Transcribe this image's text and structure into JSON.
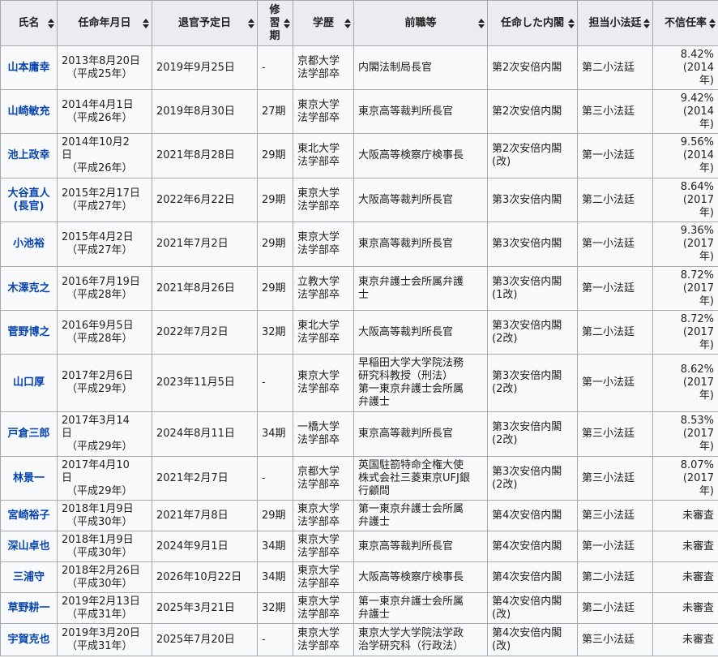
{
  "headers": [
    "氏名",
    "任命年月日",
    "退官予定日",
    "修習期",
    "学歴",
    "前職等",
    "任命した内閣",
    "担当小法廷",
    "不信任率"
  ],
  "rows": [
    {
      "name": "山本庸幸",
      "appoint": "2013年8月20日",
      "era": "（平成25年）",
      "retire": "2019年9月25日",
      "term": "-",
      "edu1": "京都大学",
      "edu2": "法学部",
      "edu_suffix": "卒",
      "edu_link": true,
      "prev1": "内閣法制局長官",
      "prev2": "",
      "prev3": "",
      "prev_link1": false,
      "cabinet": "第2次安倍内閣",
      "court": "第二小法廷",
      "rate": "8.42%",
      "rate2": "(2014",
      "rate3": "年)"
    },
    {
      "name": "山崎敏充",
      "appoint": "2014年4月1日",
      "era": "（平成26年）",
      "retire": "2019年8月30日",
      "term": "27期",
      "edu1": "東京大学",
      "edu2": "法学部",
      "edu_suffix": "卒",
      "edu_link": true,
      "prev1": "東京高等裁判所長官",
      "prev2": "",
      "prev3": "",
      "prev_link1": false,
      "cabinet": "第2次安倍内閣",
      "court": "第三小法廷",
      "rate": "9.42%",
      "rate2": "(2014",
      "rate3": "年)"
    },
    {
      "name": "池上政幸",
      "appoint": "2014年10月2",
      "appoint2": "日",
      "era": "（平成26年）",
      "retire": "2021年8月28日",
      "term": "29期",
      "edu1": "東北大学",
      "edu2": "法学部",
      "edu_suffix": "卒",
      "edu_link": true,
      "prev1": "大阪高等検察庁検事長",
      "prev2": "",
      "prev3": "",
      "prev_link1": false,
      "cabinet": "第2次安倍内閣",
      "cabinet2": "(改)",
      "court": "第一小法廷",
      "rate": "9.56%",
      "rate2": "(2014",
      "rate3": "年)"
    },
    {
      "name": "大谷直人",
      "name2": "(長官)",
      "appoint": "2015年2月17日",
      "era": "（平成27年）",
      "retire": "2022年6月22日",
      "term": "29期",
      "edu1": "東京大学",
      "edu2": "法学部卒",
      "edu_suffix": "",
      "edu_link": false,
      "prev1": "大阪高等裁判所長官",
      "prev2": "",
      "prev3": "",
      "prev_link1": false,
      "cabinet": "第3次安倍内閣",
      "court": "第二小法廷",
      "rate": "8.64%",
      "rate2": "(2017",
      "rate3": "年)"
    },
    {
      "name": "小池裕",
      "appoint": "2015年4月2日",
      "era": "（平成27年）",
      "retire": "2021年7月2日",
      "term": "29期",
      "edu1": "東京大学",
      "edu2": "法学部卒",
      "edu_suffix": "",
      "edu_link": false,
      "prev1": "東京高等裁判所長官",
      "prev2": "",
      "prev3": "",
      "prev_link1": false,
      "cabinet": "第3次安倍内閣",
      "court": "第一小法廷",
      "rate": "9.36%",
      "rate2": "(2017",
      "rate3": "年)"
    },
    {
      "name": "木澤克之",
      "appoint": "2016年7月19日",
      "era": "（平成28年）",
      "retire": "2021年8月26日",
      "term": "29期",
      "edu1": "立教大学",
      "edu2": "法学部",
      "edu_suffix": "卒",
      "edu_link": true,
      "prev1": "東京弁護士会所属弁護",
      "prev2": "士",
      "prev3": "",
      "prev_link1": false,
      "cabinet": "第3次安倍内閣",
      "cabinet2": "(1改)",
      "court": "第一小法廷",
      "rate": "8.72%",
      "rate2": "(2017",
      "rate3": "年)"
    },
    {
      "name": "菅野博之",
      "appoint": "2016年9月5日",
      "era": "（平成28年）",
      "retire": "2022年7月2日",
      "term": "32期",
      "edu1": "東北大学",
      "edu2": "法学部卒",
      "edu_suffix": "",
      "edu_link": false,
      "prev1": "大阪高等裁判所長官",
      "prev2": "",
      "prev3": "",
      "prev_link1": false,
      "cabinet": "第3次安倍内閣",
      "cabinet2": "(2改)",
      "court": "第二小法廷",
      "rate": "8.72%",
      "rate2": "(2017",
      "rate3": "年)"
    },
    {
      "name": "山口厚",
      "appoint": "2017年2月6日",
      "era": "（平成29年）",
      "retire": "2023年11月5日",
      "term": "-",
      "edu1": "東京大学",
      "edu2": "法学部卒",
      "edu_suffix": "",
      "edu_link": false,
      "prev1": "早稲田大学大学院法務",
      "prev2": "研究科",
      "prev2b": "教授（刑法）",
      "prev3": "第一東京弁護士会所属",
      "prev4": "弁護士",
      "prev_link1": true,
      "cabinet": "第3次安倍内閣",
      "cabinet2": "(2改)",
      "court": "第一小法廷",
      "rate": "8.62%",
      "rate2": "(2017",
      "rate3": "年)"
    },
    {
      "name": "戸倉三郎",
      "appoint": "2017年3月14",
      "appoint2": "日",
      "era": "（平成29年）",
      "retire": "2024年8月11日",
      "term": "34期",
      "edu1": "一橋大学",
      "edu2": "法学部",
      "edu_suffix": "卒",
      "edu_link": true,
      "prev1": "東京高等裁判所長官",
      "prev2": "",
      "prev3": "",
      "prev_link1": false,
      "cabinet": "第3次安倍内閣",
      "cabinet2": "(2改)",
      "court": "第三小法廷",
      "rate": "8.53%",
      "rate2": "(2017",
      "rate3": "年)"
    },
    {
      "name": "林景一",
      "appoint": "2017年4月10",
      "appoint2": "日",
      "era": "（平成29年）",
      "retire": "2021年2月7日",
      "term": "-",
      "edu1": "京都大学",
      "edu2": "法学部卒",
      "edu_suffix": "",
      "edu_link": false,
      "prev1": "英国駐箚特命全権大使",
      "prev2": "株式会社",
      "prev2b": "三菱東京UFJ銀",
      "prev3": "行",
      "prev3b": "顧問",
      "prev_link1": false,
      "cabinet": "第3次安倍内閣",
      "cabinet2": "(2改)",
      "court": "第三小法廷",
      "rate": "8.07%",
      "rate2": "(2017",
      "rate3": "年)"
    },
    {
      "name": "宮崎裕子",
      "appoint": "2018年1月9日",
      "era": "（平成30年）",
      "retire": "2021年7月8日",
      "term": "29期",
      "edu1": "東京大学",
      "edu2": "法学部卒",
      "edu_suffix": "",
      "edu_link": false,
      "prev1": "第一東京弁護士会所属",
      "prev2": "弁護士",
      "prev3": "",
      "prev_link1": false,
      "cabinet": "第4次安倍内閣",
      "court": "第三小法廷",
      "rate": "未審査"
    },
    {
      "name": "深山卓也",
      "appoint": "2018年1月9日",
      "era": "（平成30年）",
      "retire": "2024年9月1日",
      "term": "34期",
      "edu1": "東京大学",
      "edu2": "法学部卒",
      "edu_suffix": "",
      "edu_link": false,
      "prev1": "東京高等裁判所長官",
      "prev2": "",
      "prev3": "",
      "prev_link1": false,
      "cabinet": "第4次安倍内閣",
      "court": "第一小法廷",
      "rate": "未審査"
    },
    {
      "name": "三浦守",
      "appoint": "2018年2月26日",
      "era": "（平成30年）",
      "retire": "2026年10月22日",
      "term": "34期",
      "edu1": "東京大学",
      "edu2": "法学部卒",
      "edu_suffix": "",
      "edu_link": false,
      "prev1": "大阪高等検察庁検事長",
      "prev2": "",
      "prev3": "",
      "prev_link1": false,
      "cabinet": "第4次安倍内閣",
      "court": "第二小法廷",
      "rate": "未審査"
    },
    {
      "name": "草野耕一",
      "appoint": "2019年2月13日",
      "era": "（平成31年）",
      "retire": "2025年3月21日",
      "term": "32期",
      "edu1": "東京大学",
      "edu2": "法学部卒",
      "edu_suffix": "",
      "edu_link": false,
      "prev1": "第一東京弁護士会所属",
      "prev2": "弁護士",
      "prev3": "",
      "prev_link1": false,
      "cabinet": "第4次安倍内閣",
      "cabinet2": "(改)",
      "court": "第二小法廷",
      "rate": "未審査"
    },
    {
      "name": "宇賀克也",
      "appoint": "2019年3月20日",
      "era": "（平成31年）",
      "retire": "2025年7月20日",
      "term": "-",
      "edu1": "東京大学",
      "edu2": "法学部卒",
      "edu_suffix": "",
      "edu_link": false,
      "prev1": "東京大学大学院法学政",
      "prev2": "治学研究科",
      "prev2b": "（行政法）",
      "prev3": "",
      "prev_link1": true,
      "cabinet": "第4次安倍内閣",
      "cabinet2": "(改)",
      "court": "第三小法廷",
      "rate": "未審査"
    }
  ],
  "colors": {
    "link": "#0645ad",
    "header_bg": "#eaecf0",
    "cell_bg": "#f8f9fa",
    "border": "#a2a9b1"
  }
}
